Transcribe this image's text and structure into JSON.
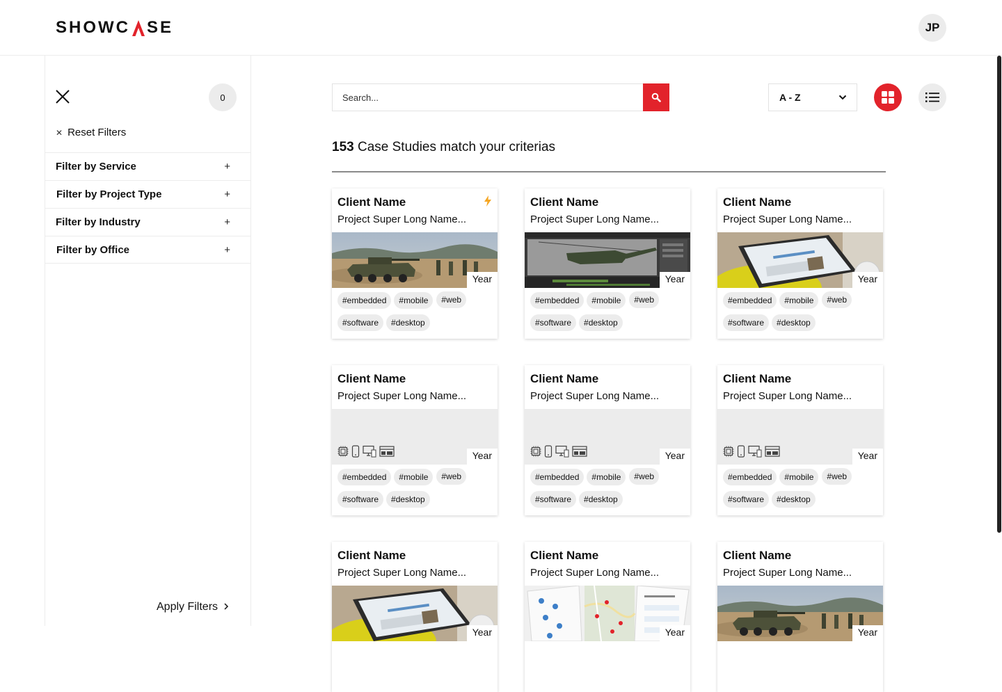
{
  "header": {
    "logo_text": "SHOWCASE",
    "logo_prefix": "SHOWC",
    "logo_suffix": "SE",
    "user_initials": "JP"
  },
  "sidebar": {
    "selected_count": "0",
    "reset_label": "Reset Filters",
    "filters": [
      {
        "label": "Filter by Service"
      },
      {
        "label": "Filter by Project Type"
      },
      {
        "label": "Filter by Industry"
      },
      {
        "label": "Filter by Office"
      }
    ],
    "apply_label": "Apply Filters"
  },
  "toolbar": {
    "search_placeholder": "Search...",
    "sort_value": "A - Z"
  },
  "results": {
    "count": "153",
    "text": "Case Studies match your criterias"
  },
  "cards": [
    {
      "client": "Client Name",
      "project": "Project Super Long Name...",
      "year": "Year",
      "thumb": "tank",
      "featured": true,
      "tags": [
        "#embedded",
        "#mobile",
        "#web",
        "#software",
        "#desktop"
      ]
    },
    {
      "client": "Client Name",
      "project": "Project Super Long Name...",
      "year": "Year",
      "thumb": "helicopter",
      "featured": false,
      "tags": [
        "#embedded",
        "#mobile",
        "#web",
        "#software",
        "#desktop"
      ]
    },
    {
      "client": "Client Name",
      "project": "Project Super Long Name...",
      "year": "Year",
      "thumb": "laptop",
      "featured": false,
      "tags": [
        "#embedded",
        "#mobile",
        "#web",
        "#software",
        "#desktop"
      ]
    },
    {
      "client": "Client Name",
      "project": "Project Super Long Name...",
      "year": "Year",
      "thumb": "placeholder",
      "featured": false,
      "tags": [
        "#embedded",
        "#mobile",
        "#web",
        "#software",
        "#desktop"
      ]
    },
    {
      "client": "Client Name",
      "project": "Project Super Long Name...",
      "year": "Year",
      "thumb": "placeholder",
      "featured": false,
      "tags": [
        "#embedded",
        "#mobile",
        "#web",
        "#software",
        "#desktop"
      ]
    },
    {
      "client": "Client Name",
      "project": "Project Super Long Name...",
      "year": "Year",
      "thumb": "placeholder",
      "featured": false,
      "tags": [
        "#embedded",
        "#mobile",
        "#web",
        "#software",
        "#desktop"
      ]
    },
    {
      "client": "Client Name",
      "project": "Project Super Long Name...",
      "year": "Year",
      "thumb": "laptop",
      "featured": false,
      "tags": []
    },
    {
      "client": "Client Name",
      "project": "Project Super Long Name...",
      "year": "Year",
      "thumb": "map",
      "featured": false,
      "tags": []
    },
    {
      "client": "Client Name",
      "project": "Project Super Long Name...",
      "year": "Year",
      "thumb": "tank",
      "featured": false,
      "tags": []
    }
  ],
  "colors": {
    "accent": "#e2232b",
    "bolt": "#f5a623",
    "chip_bg": "#ececec"
  }
}
